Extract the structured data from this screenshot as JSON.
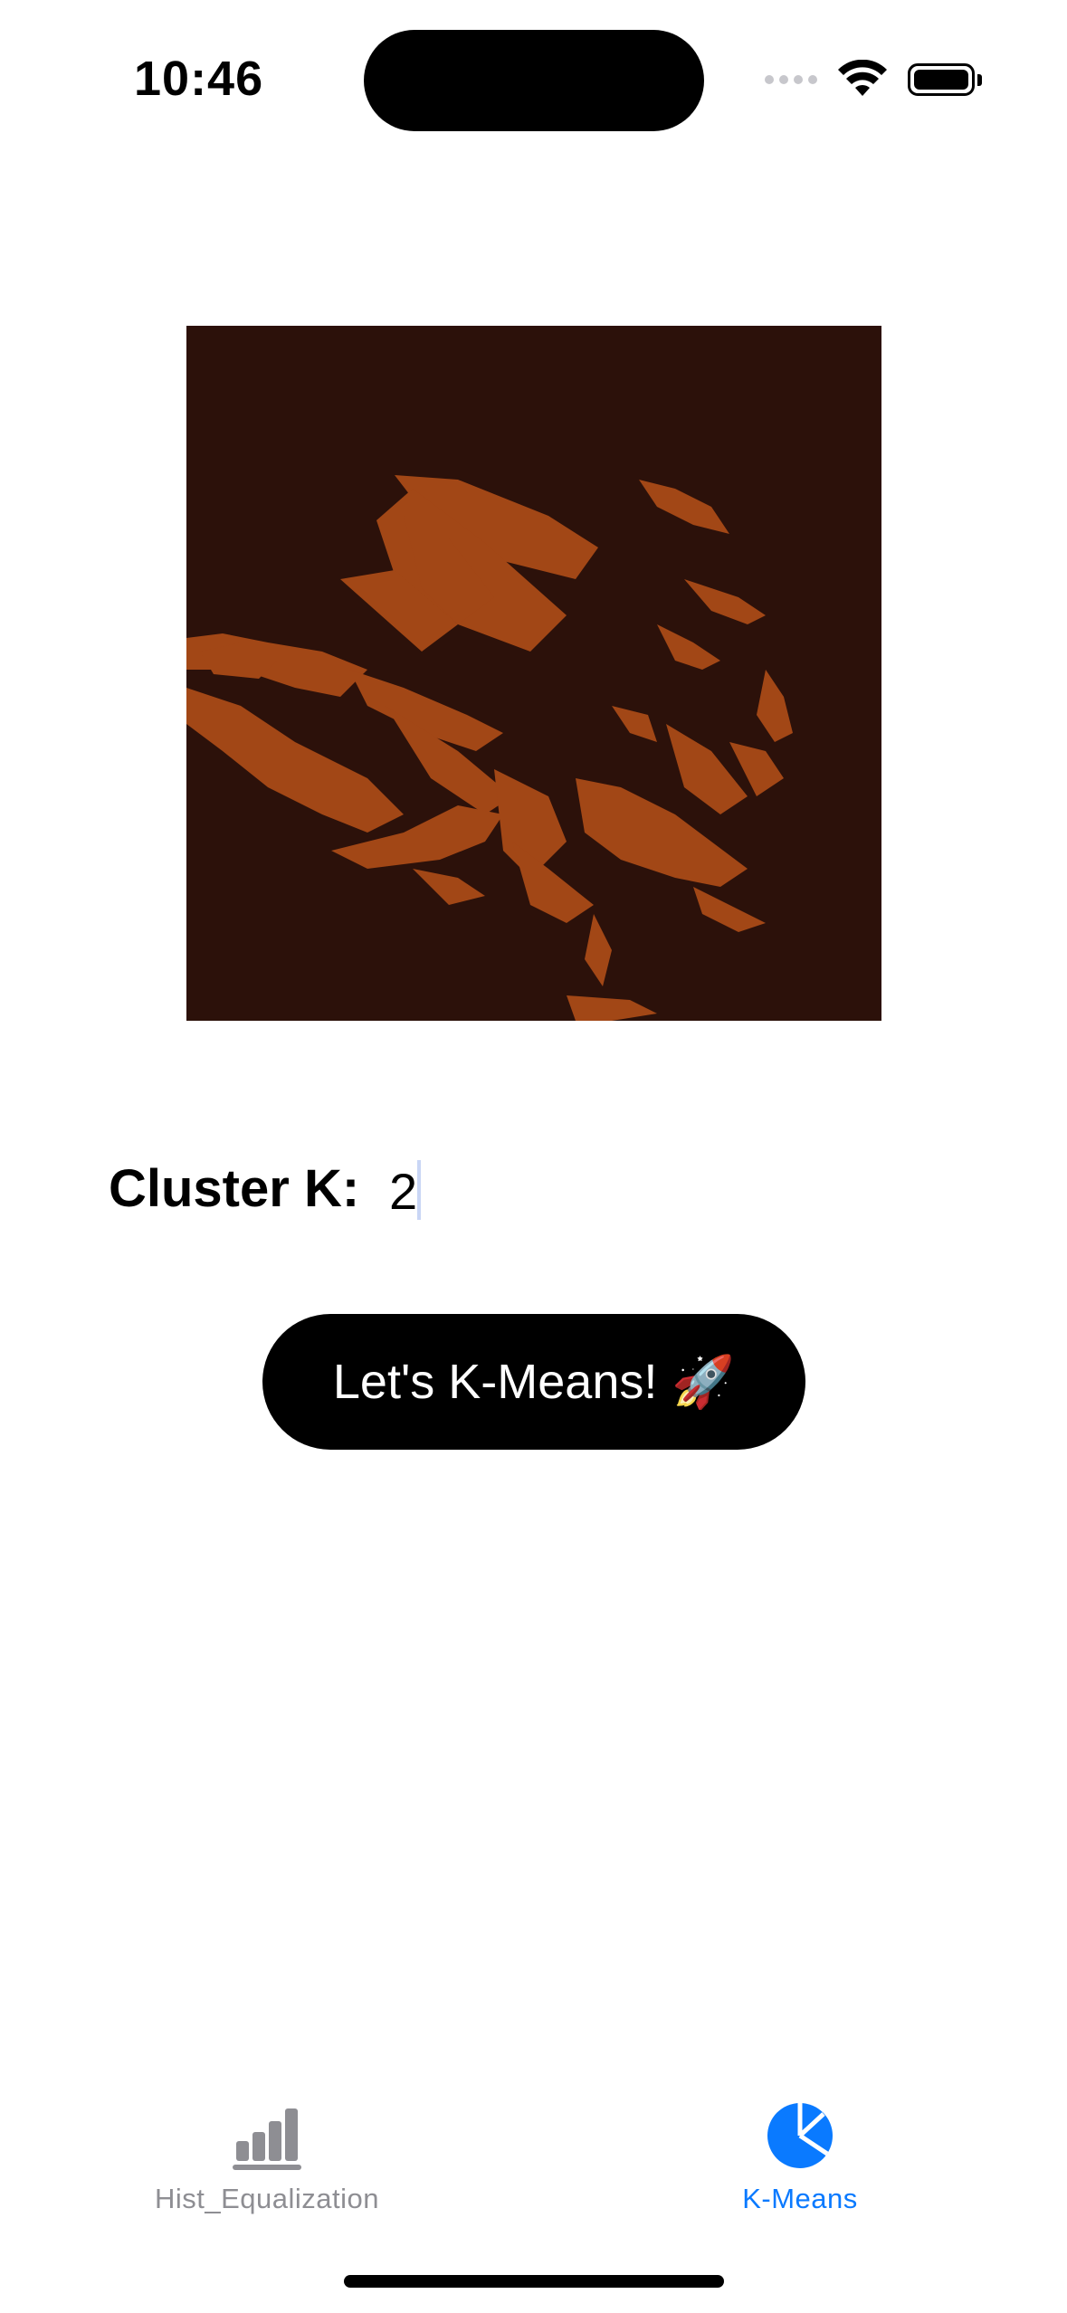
{
  "status_bar": {
    "time": "10:46"
  },
  "result_image": {
    "description_colors": {
      "background": "#2c110a",
      "cluster": "#a24716"
    }
  },
  "cluster": {
    "label": "Cluster K:",
    "value": "2"
  },
  "action_button": {
    "label": "Let's K-Means!",
    "emoji": "🚀"
  },
  "tab_bar": {
    "tabs": [
      {
        "label": "Hist_Equalization",
        "icon": "bar-chart-icon",
        "selected": false
      },
      {
        "label": "K-Means",
        "icon": "pie-chart-icon",
        "selected": true
      }
    ]
  },
  "colors": {
    "accent": "#0a7aff",
    "inactive": "#8e8e93",
    "button_bg": "#000000"
  }
}
